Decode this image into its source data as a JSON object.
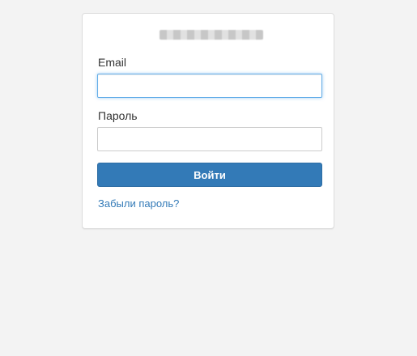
{
  "login": {
    "email_label": "Email",
    "email_value": "",
    "email_placeholder": "",
    "password_label": "Пароль",
    "password_value": "",
    "password_placeholder": "",
    "submit_label": "Войти",
    "forgot_link": "Забыли пароль?"
  },
  "colors": {
    "page_background": "#f3f3f3",
    "primary": "#337ab7",
    "link": "#337ab7",
    "focus_border": "#66afe9"
  }
}
